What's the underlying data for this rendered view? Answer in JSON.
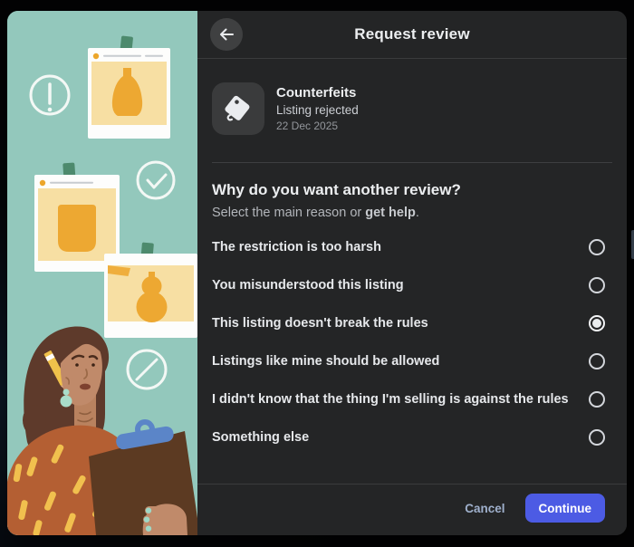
{
  "dialog": {
    "header": {
      "title": "Request review"
    },
    "item": {
      "icon": "tag-icon",
      "name": "Counterfeits",
      "status": "Listing rejected",
      "date": "22 Dec 2025"
    },
    "question": {
      "heading": "Why do you want another review?",
      "subtitle_prefix": "Select the main reason or ",
      "subtitle_link": "get help",
      "subtitle_suffix": "."
    },
    "options": [
      {
        "label": "The restriction is too harsh",
        "selected": false
      },
      {
        "label": "You misunderstood this listing",
        "selected": false
      },
      {
        "label": "This listing doesn't break the rules",
        "selected": true
      },
      {
        "label": "Listings like mine should be allowed",
        "selected": false
      },
      {
        "label": "I didn't know that the thing I'm selling is against the rules",
        "selected": false
      },
      {
        "label": "Something else",
        "selected": false
      }
    ],
    "footer": {
      "cancel": "Cancel",
      "continue": "Continue"
    }
  },
  "colors": {
    "accent_blue": "#4c5be4",
    "cancel_link": "#9fb0cc",
    "dialog_bg": "#242526",
    "tile_bg": "#3a3b3c",
    "panel_teal": "#93c8bc",
    "photo_yellow": "#f7dfa3",
    "item_orange": "#eda832",
    "tape_green": "#4d8a6d",
    "radio_border": "#d3d6db"
  },
  "illustration_icons": [
    "exclamation-circle-icon",
    "check-circle-icon",
    "prohibited-circle-icon"
  ]
}
